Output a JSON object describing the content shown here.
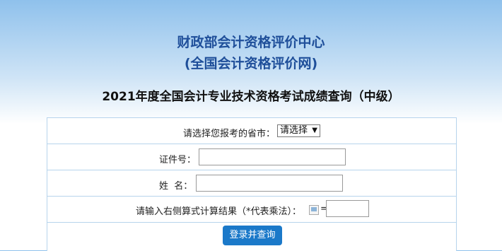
{
  "header": {
    "org_line1": "财政部会计资格评价中心",
    "org_line2": "(全国会计资格评价网)",
    "title": "2021年度全国会计专业技术资格考试成绩查询（中级）"
  },
  "form": {
    "province_label": "请选择您报考的省市：",
    "province_selected": "请选择",
    "id_label": "证件号：",
    "id_value": "",
    "name_label": "姓  名：",
    "name_value": "",
    "captcha_label": "请输入右侧算式计算结果（*代表乘法）：",
    "captcha_equals": "=",
    "captcha_value": "",
    "submit_label": "登录并查询"
  }
}
